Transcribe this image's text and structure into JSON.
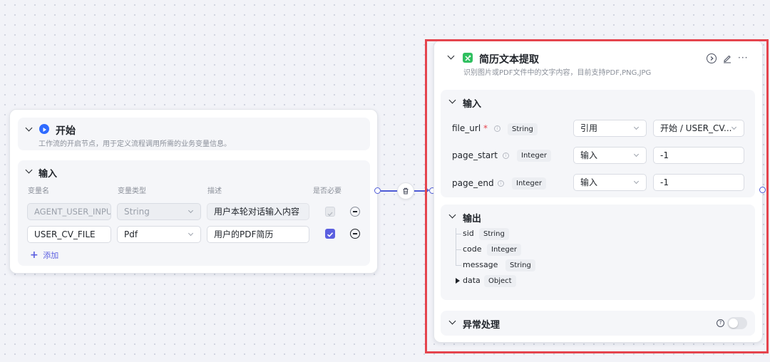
{
  "start_node": {
    "title": "开始",
    "description": "工作流的开启节点，用于定义流程调用所需的业务变量信息。",
    "input_section": {
      "title": "输入",
      "columns": [
        "变量名",
        "变量类型",
        "描述",
        "是否必要"
      ],
      "rows": [
        {
          "name": "AGENT_USER_INPUT",
          "type": "String",
          "desc": "用户本轮对话输入内容",
          "required": true,
          "disabled": true
        },
        {
          "name": "USER_CV_FILE",
          "type": "Pdf",
          "desc": "用户的PDF简历",
          "required": true,
          "disabled": false
        }
      ],
      "add_label": "添加"
    }
  },
  "resume_node": {
    "title": "简历文本提取",
    "description": "识别图片或PDF文件中的文字内容，目前支持PDF,PNG,JPG",
    "input_section": {
      "title": "输入",
      "params": [
        {
          "name": "file_url",
          "required_mark": "*",
          "type": "String",
          "source": "引用",
          "value": "开始 / USER_CV..."
        },
        {
          "name": "page_start",
          "required_mark": "",
          "type": "Integer",
          "source": "输入",
          "value": "-1"
        },
        {
          "name": "page_end",
          "required_mark": "",
          "type": "Integer",
          "source": "输入",
          "value": "-1"
        }
      ]
    },
    "output_section": {
      "title": "输出",
      "fields": [
        {
          "name": "sid",
          "type": "String"
        },
        {
          "name": "code",
          "type": "Integer"
        },
        {
          "name": "message",
          "type": "String"
        },
        {
          "name": "data",
          "type": "Object"
        }
      ]
    },
    "exception_section": {
      "title": "异常处理",
      "toggle_on": false
    }
  },
  "colors": {
    "accent": "#5b5fe0",
    "port": "#4e5bd6",
    "highlight_border": "#e5444d",
    "start_icon": "#2f6bff",
    "resume_icon": "#2fbf5f"
  }
}
